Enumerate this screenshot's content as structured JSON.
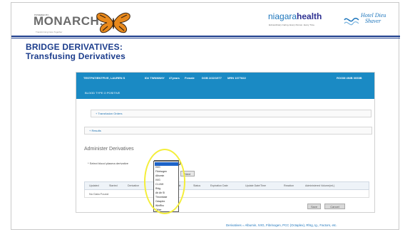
{
  "header": {
    "logo_small": "POWERED BY",
    "logo_text": "MONARCH:",
    "logo_tagline": "Transforming Care Together",
    "hospital_name_light": "niagara",
    "hospital_name_bold": "health",
    "hospital_tagline": "Extraordinary Caring. Every Person. Every Time.",
    "partner_line1": "Hotel Dieu",
    "partner_line2": "Shaver"
  },
  "slide": {
    "title_line1": "BRIDGE DERIVATIVES:",
    "title_line2": "Transfusing Derivatives",
    "footer": "Derivatives = Albumin, IVIG, Fibrinogen, PCC (Octaplex), RhIg, Ig., Factors, etc."
  },
  "patient_banner": {
    "name": "TESTPATIENTFIVE, LAUREN S",
    "mrn": "ID# TWNNNNY",
    "age": "47years",
    "sex": "Female",
    "dob": "DOB 2/22/1977",
    "mrn2": "MRN 1077822",
    "room": "ROOM 4NIB 0053B",
    "blood_type": "BLOOD TYPE O POSITIVE"
  },
  "sections": {
    "transfusion_orders": "+ Transfusion Orders",
    "results": "+ Results"
  },
  "administer": {
    "title": "Administer Derivatives",
    "select_label": "* Select blood plasma derivative",
    "go_label": "Next",
    "table_headers": [
      "Updated",
      "Started",
      "Derivative",
      "Dose",
      "Unit",
      "Status",
      "Expiration Date",
      "Update Date/Time",
      "Reaction",
      "Administered Volume(mL)"
    ],
    "no_data": "No Data Found",
    "save_label": "Save",
    "cancel_label": "Cancel"
  },
  "dropdown": {
    "options": [
      "",
      "IVIG",
      "Fibrinogen",
      "Albumin",
      "IVIG",
      "C1-INH",
      "RhIg",
      "Ab Ab Sl",
      "Thrombate",
      "Octaplex",
      "WinRho",
      "Other"
    ]
  },
  "colors": {
    "banner": "#1a8ac4",
    "title": "#1c3d8c",
    "highlight": "#f4ee3a"
  }
}
